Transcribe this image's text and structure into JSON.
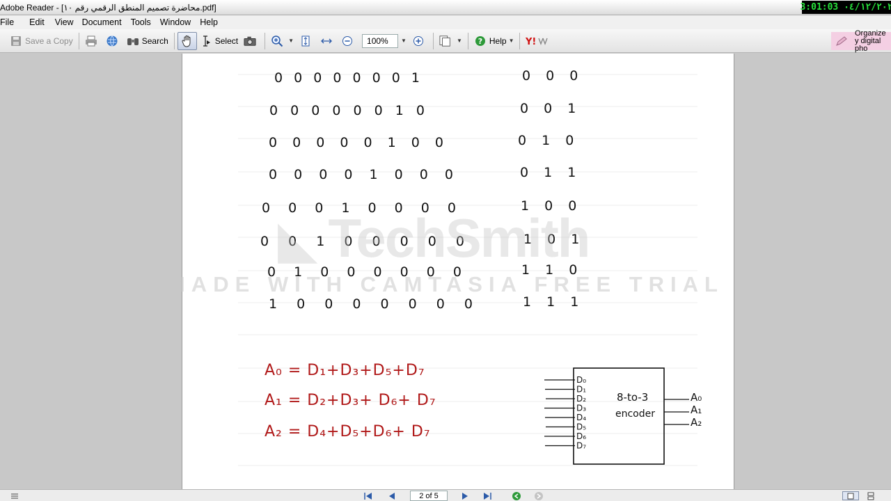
{
  "window": {
    "title": "Adobe Reader - [محاضرة تصميم المنطق الرقمي رقم ١٠.pdf]",
    "clock": "3:01:03 ٠٤/١٢/٢٠٢"
  },
  "menu": [
    "File",
    "Edit",
    "View",
    "Document",
    "Tools",
    "Window",
    "Help"
  ],
  "toolbar": {
    "save_copy": "Save a Copy",
    "search": "Search",
    "select": "Select",
    "zoom": "100%",
    "help": "Help",
    "organize": "Organize y digital pho"
  },
  "document": {
    "truth_table_inputs": [
      "0 0 0 0 0 0 0 1",
      "0 0 0 0 0 0 1 0",
      "0 0 0 0 0 1 0 0",
      "0 0 0 0 1 0 0 0",
      "0 0 0 1 0 0 0 0",
      "0 0 1 0 0 0 0 0",
      "0 1 0 0 0 0 0 0",
      "1 0 0 0 0 0 0 0"
    ],
    "truth_table_outputs": [
      "0 0 0",
      "0 0 1",
      "0 1 0",
      "0 1 1",
      "1 0 0",
      "1 0 1",
      "1 1 0",
      "1 1 1"
    ],
    "equations": [
      "A₀ = D₁+D₃+D₅+D₇",
      "A₁ = D₂+D₃+ D₆+ D₇",
      "A₂ = D₄+D₅+D₆+ D₇"
    ],
    "encoder_block": {
      "title_line1": "8-to-3",
      "title_line2": "encoder",
      "inputs": [
        "D₀",
        "D₁",
        "D₂",
        "D₃",
        "D₄",
        "D₅",
        "D₆",
        "D₇"
      ],
      "outputs": [
        "A₀",
        "A₁",
        "A₂"
      ]
    },
    "watermark_brand": "TechSmith",
    "watermark_text": "MADE WITH CAMTASIA FREE TRIAL"
  },
  "statusbar": {
    "page_indicator": "2 of 5"
  },
  "colors": {
    "equation_ink": "#b01818",
    "clock_text": "#27e03b"
  }
}
